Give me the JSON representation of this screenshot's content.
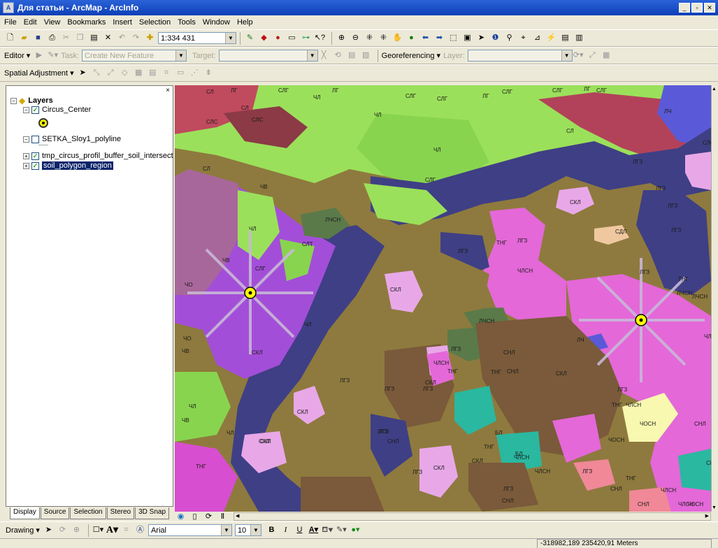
{
  "window": {
    "title": "Для статьи - ArcMap - ArcInfo",
    "controls": {
      "minimize": "_",
      "maximize": "▫",
      "close": "✕"
    }
  },
  "menu": [
    "File",
    "Edit",
    "View",
    "Bookmarks",
    "Insert",
    "Selection",
    "Tools",
    "Window",
    "Help"
  ],
  "standard_toolbar": {
    "scale": "1:334 431"
  },
  "editor_toolbar": {
    "editor_label": "Editor ▾",
    "task_label": "Task:",
    "task_value": "Create New Feature",
    "target_label": "Target:",
    "target_value": "",
    "georeferencing_label": "Georeferencing ▾",
    "layer_label": "Layer:",
    "layer_value": ""
  },
  "spatial_toolbar": {
    "label": "Spatial Adjustment ▾"
  },
  "toc": {
    "close": "×",
    "root": "Layers",
    "layers": [
      {
        "name": "Circus_Center",
        "checked": "✓"
      },
      {
        "name": "SETKA_Sloy1_polyline",
        "checked": ""
      },
      {
        "name": "tmp_circus_profil_buffer_soil_intersect",
        "checked": "✓"
      },
      {
        "name": "soil_polygon_region",
        "checked": "✓"
      }
    ],
    "tabs": [
      "Display",
      "Source",
      "Selection",
      "Stereo",
      "3D Snap"
    ]
  },
  "map": {
    "labels": [
      "СЛ",
      "ЛГ",
      "СЛГ",
      "ЛГ",
      "СЛ",
      "ЧЛ",
      "СЛС",
      "СЛС",
      "ЧЛ",
      "СЛГ",
      "СЛГ",
      "ЛГ",
      "СЛГ",
      "СЛГ",
      "ЛГ",
      "СЛГ",
      "ЛЧ",
      "СЛ",
      "СЛС",
      "СЛГ",
      "ЧЛ",
      "ЛГЗ",
      "ЛГЗ",
      "СКЛ",
      "СЛ",
      "ЧВ",
      "ЧЛ",
      "СЛТ",
      "СЛГ",
      "ЛЧСН",
      "СКЛ",
      "ЛГЗ",
      "СДЛ",
      "ЛГЗ",
      "ЛГЗ",
      "ЛГЗ",
      "ЧВ",
      "ЧО",
      "ЧЛ",
      "ЛГЗ",
      "СКЛ",
      "ТНГ",
      "ЧЛСН",
      "ЛГЗ",
      "ЛЧСН",
      "ТНГ",
      "ЛЧСН",
      "ЛЧСН",
      "ЛЧ",
      "ЧЛСН",
      "ЧО",
      "ЧВ",
      "СКЛ",
      "ЛГЗ",
      "ЧЛСН",
      "СКЛ",
      "СНЛ",
      "СНЛ",
      "ТНГ",
      "ТНГ",
      "ЛГЗ",
      "ЛГЗ",
      "ЧЛ",
      "ЧВ",
      "СКЛ",
      "ЛГЗ",
      "СКЛ",
      "БЛ",
      "ЛГЗ",
      "ЧЛ",
      "СКЛ",
      "ЛГЗ",
      "СНЛ",
      "СКЛ",
      "СКЛ",
      "ТНГ",
      "БЛ",
      "ЧЛСН",
      "ТНГ",
      "ЧЛСН",
      "ЛГЗ",
      "СНЛ",
      "ТНГ",
      "ЛГЗ",
      "ЧЛСН",
      "СНЛ",
      "ТНГ",
      "ЛГЗ",
      "СНЛ",
      "ЧОСН",
      "ЧЛСН",
      "ЧЛСН",
      "ЧОСН",
      "СНЛ",
      "СНЛ",
      "ЧОСН",
      "БЛ",
      "ЧЛСН"
    ]
  },
  "drawing_toolbar": {
    "label": "Drawing ▾",
    "font": "Arial",
    "size": "10"
  },
  "status": {
    "coords": "-318982,189 235420,91 Meters"
  },
  "colors": {
    "title_bar": "#0d3fb7",
    "chrome": "#ece9d8",
    "selection": "#0a246a"
  }
}
